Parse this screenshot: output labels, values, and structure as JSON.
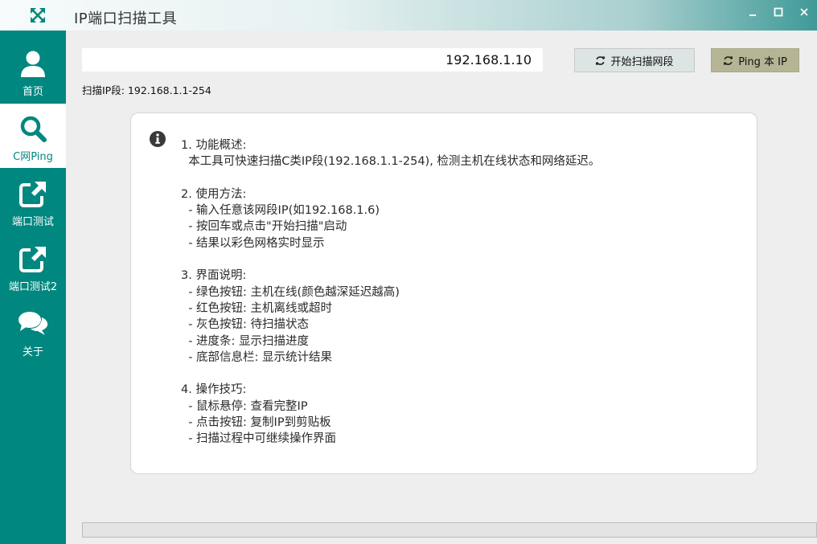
{
  "window": {
    "title": "IP端口扫描工具",
    "app_icon": "expand-arrows-icon",
    "controls": [
      "minimize-icon",
      "maximize-icon",
      "close-icon"
    ]
  },
  "sidebar": {
    "items": [
      {
        "label": "首页",
        "icon": "user-icon",
        "active": false
      },
      {
        "label": "C网Ping",
        "icon": "search-icon",
        "active": true
      },
      {
        "label": "端口测试",
        "icon": "external-link-icon",
        "active": false
      },
      {
        "label": "端口测试2",
        "icon": "external-link-icon",
        "active": false
      },
      {
        "label": "关于",
        "icon": "chat-bubbles-icon",
        "active": false
      }
    ]
  },
  "toolbar": {
    "ip_value": "192.168.1.10",
    "scan_label": "开始扫描网段",
    "ping_label": "Ping 本 IP",
    "range_text": "扫描IP段: 192.168.1.1-254"
  },
  "help": {
    "text": "1. 功能概述:\n  本工具可快速扫描C类IP段(192.168.1.1-254), 检测主机在线状态和网络延迟。\n\n2. 使用方法:\n  - 输入任意该网段IP(如192.168.1.6)\n  - 按回车或点击\"开始扫描\"启动\n  - 结果以彩色网格实时显示\n\n3. 界面说明:\n  - 绿色按钮: 主机在线(颜色越深延迟越高)\n  - 红色按钮: 主机离线或超时\n  - 灰色按钮: 待扫描状态\n  - 进度条: 显示扫描进度\n  - 底部信息栏: 显示统计结果\n\n4. 操作技巧:\n  - 鼠标悬停: 查看完整IP\n  - 点击按钮: 复制IP到剪贴板\n  - 扫描过程中可继续操作界面"
  },
  "progress": {
    "value": 0
  },
  "colors": {
    "accent": "#00877f",
    "scan_button": "#dde4e4",
    "ping_button": "#b5b495",
    "background": "#eeeeee"
  }
}
